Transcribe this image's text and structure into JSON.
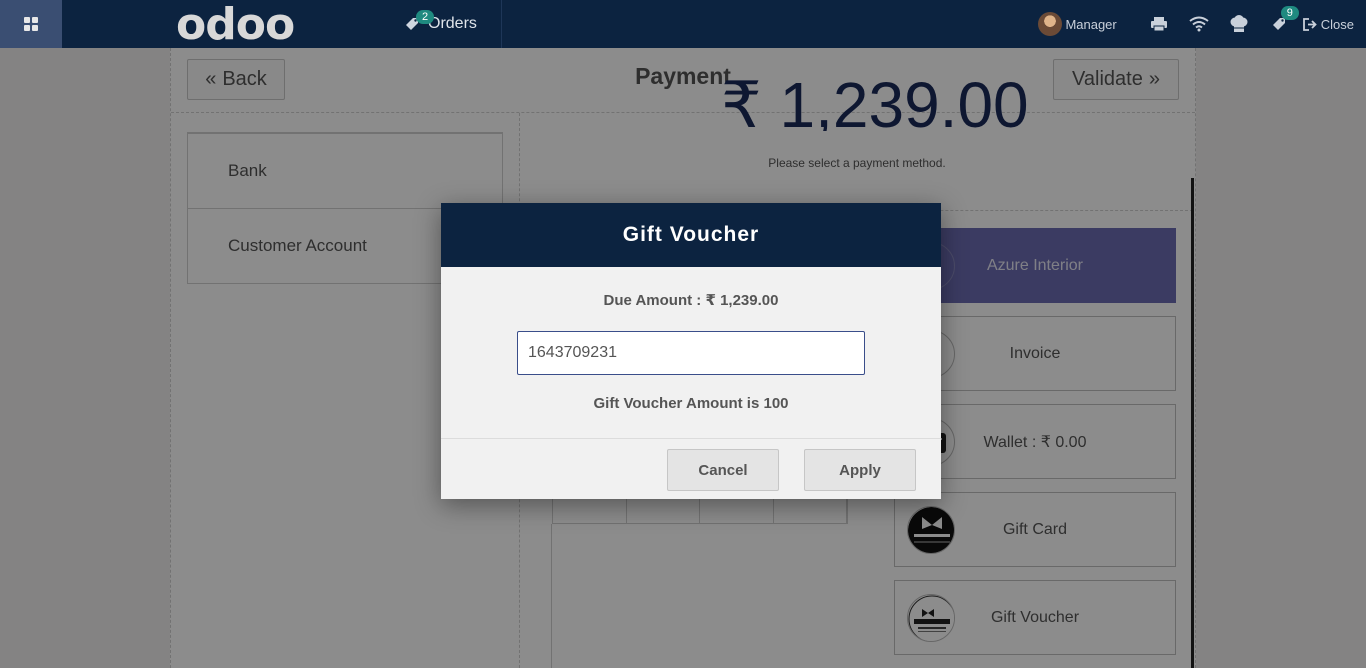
{
  "navbar": {
    "logo": "odoo",
    "orders_label": "Orders",
    "orders_badge": "2",
    "user_name": "Manager",
    "sync_badge": "9",
    "close_label": "Close"
  },
  "header": {
    "back_label": "Back",
    "title": "Payment",
    "validate_label": "Validate"
  },
  "payment_lines": [
    {
      "label": ""
    },
    {
      "label": "Bank"
    },
    {
      "label": "Customer Account"
    }
  ],
  "summary": {
    "total_partial": "₹ 1,239.00",
    "hint": "Please select a payment method."
  },
  "methods": [
    {
      "label": "Azure Interior",
      "icon": "customer-avatar-icon",
      "selected": true
    },
    {
      "label": "Invoice",
      "icon": "invoice-icon"
    },
    {
      "label": "Wallet : ₹ 0.00",
      "icon": "wallet-icon"
    },
    {
      "label": "Gift Card",
      "icon": "gift-card-icon"
    },
    {
      "label": "Gift Voucher",
      "icon": "gift-voucher-icon"
    }
  ],
  "modal": {
    "title": "Gift Voucher",
    "due_amount": "Due Amount : ₹ 1,239.00",
    "voucher_code": "1643709231",
    "voucher_message": "Gift Voucher Amount is 100",
    "cancel_label": "Cancel",
    "apply_label": "Apply"
  },
  "colors": {
    "navbar": "#0c2340",
    "apps_button": "#3a4e72",
    "badge": "#1f8a80",
    "selected_method": "#6c6cb3"
  }
}
